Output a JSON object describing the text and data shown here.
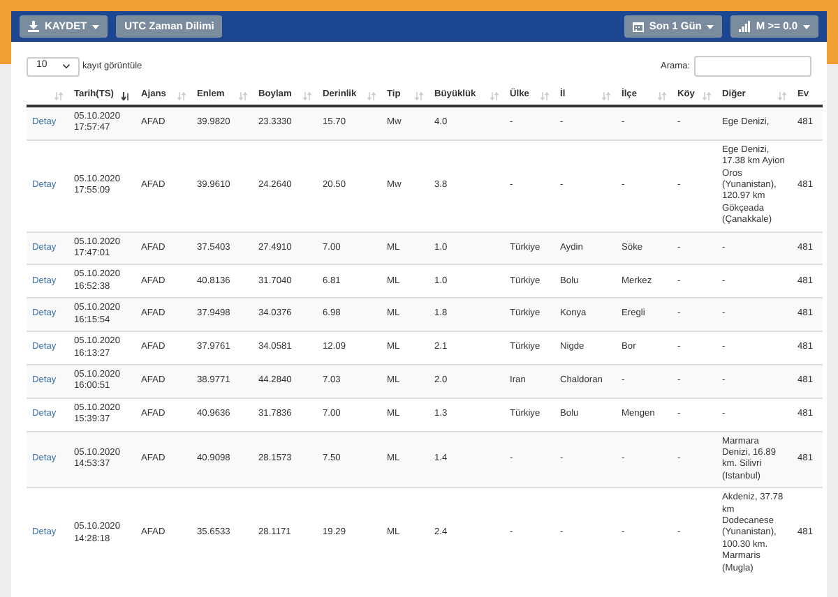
{
  "toolbar": {
    "left_buttons": [
      {
        "label": "KAYDET",
        "kind": "download"
      },
      {
        "label": "UTC Zaman Dilimi",
        "kind": "plain"
      }
    ],
    "right_buttons": [
      {
        "label": "Son 1 Gün",
        "kind": "calendar"
      },
      {
        "label": "M >= 0.0",
        "kind": "signal"
      }
    ]
  },
  "length_select": {
    "value": "10",
    "label": "kayıt görüntüle"
  },
  "search": {
    "label": "Arama:"
  },
  "table": {
    "columns": [
      {
        "sorted": false
      },
      {
        "label": "Tarih(TS)",
        "sorted": true
      },
      {
        "label": "Ajans",
        "sorted": false
      },
      {
        "label": "Enlem",
        "sorted": false
      },
      {
        "label": "Boylam",
        "sorted": false
      },
      {
        "label": "Derinlik",
        "sorted": false
      },
      {
        "label": "Tip",
        "sorted": false
      },
      {
        "label": "Büyüklük",
        "sorted": false
      },
      {
        "label": "Ülke",
        "sorted": false
      },
      {
        "label": "İl",
        "sorted": false
      },
      {
        "label": "İlçe",
        "sorted": false
      },
      {
        "label": "Köy",
        "sorted": false
      },
      {
        "label": "Diğer",
        "sorted": false
      },
      {
        "label": "Ev"
      }
    ],
    "rows": [
      {
        "cells": [
          "Detay",
          "05.10.2020 17:57:47",
          "AFAD",
          "39.9820",
          "23.3330",
          "15.70",
          "Mw",
          "4.0",
          "-",
          "-",
          "-",
          "-",
          "Ege Denizi,",
          "481"
        ]
      },
      {
        "cells": [
          "Detay",
          "05.10.2020 17:55:09",
          "AFAD",
          "39.9610",
          "24.2640",
          "20.50",
          "Mw",
          "3.8",
          "-",
          "-",
          "-",
          "-",
          "Ege Denizi, 17.38 km Ayion Oros (Yunanistan), 120.97 km Gökçeada (Çanakkale)",
          "481"
        ]
      },
      {
        "cells": [
          "Detay",
          "05.10.2020 17:47:01",
          "AFAD",
          "37.5403",
          "27.4910",
          "7.00",
          "ML",
          "1.0",
          "Türkiye",
          "Aydin",
          "Söke",
          "-",
          "-",
          "481"
        ]
      },
      {
        "cells": [
          "Detay",
          "05.10.2020 16:52:38",
          "AFAD",
          "40.8136",
          "31.7040",
          "6.81",
          "ML",
          "1.0",
          "Türkiye",
          "Bolu",
          "Merkez",
          "-",
          "-",
          "481"
        ]
      },
      {
        "cells": [
          "Detay",
          "05.10.2020 16:15:54",
          "AFAD",
          "37.9498",
          "34.0376",
          "6.98",
          "ML",
          "1.8",
          "Türkiye",
          "Konya",
          "Eregli",
          "-",
          "-",
          "481"
        ]
      },
      {
        "cells": [
          "Detay",
          "05.10.2020 16:13:27",
          "AFAD",
          "37.9761",
          "34.0581",
          "12.09",
          "ML",
          "2.1",
          "Türkiye",
          "Nigde",
          "Bor",
          "-",
          "-",
          "481"
        ]
      },
      {
        "cells": [
          "Detay",
          "05.10.2020 16:00:51",
          "AFAD",
          "38.9771",
          "44.2840",
          "7.03",
          "ML",
          "2.0",
          "Iran",
          "Chaldoran",
          "-",
          "-",
          "-",
          "481"
        ]
      },
      {
        "cells": [
          "Detay",
          "05.10.2020 15:39:37",
          "AFAD",
          "40.9636",
          "31.7836",
          "7.00",
          "ML",
          "1.3",
          "Türkiye",
          "Bolu",
          "Mengen",
          "-",
          "-",
          "481"
        ]
      },
      {
        "cells": [
          "Detay",
          "05.10.2020 14:53:37",
          "AFAD",
          "40.9098",
          "28.1573",
          "7.50",
          "ML",
          "1.4",
          "-",
          "-",
          "-",
          "-",
          "Marmara Denizi, 16.89 km. Silivri (Istanbul)",
          "481"
        ]
      },
      {
        "cells": [
          "Detay",
          "05.10.2020 14:28:18",
          "AFAD",
          "35.6533",
          "28.1171",
          "19.29",
          "ML",
          "2.4",
          "-",
          "-",
          "-",
          "-",
          "Akdeniz, 37.78 km Dodecanese (Yunanistan), 100.30 km. Marmaris (Mugla)",
          "481"
        ]
      }
    ]
  }
}
